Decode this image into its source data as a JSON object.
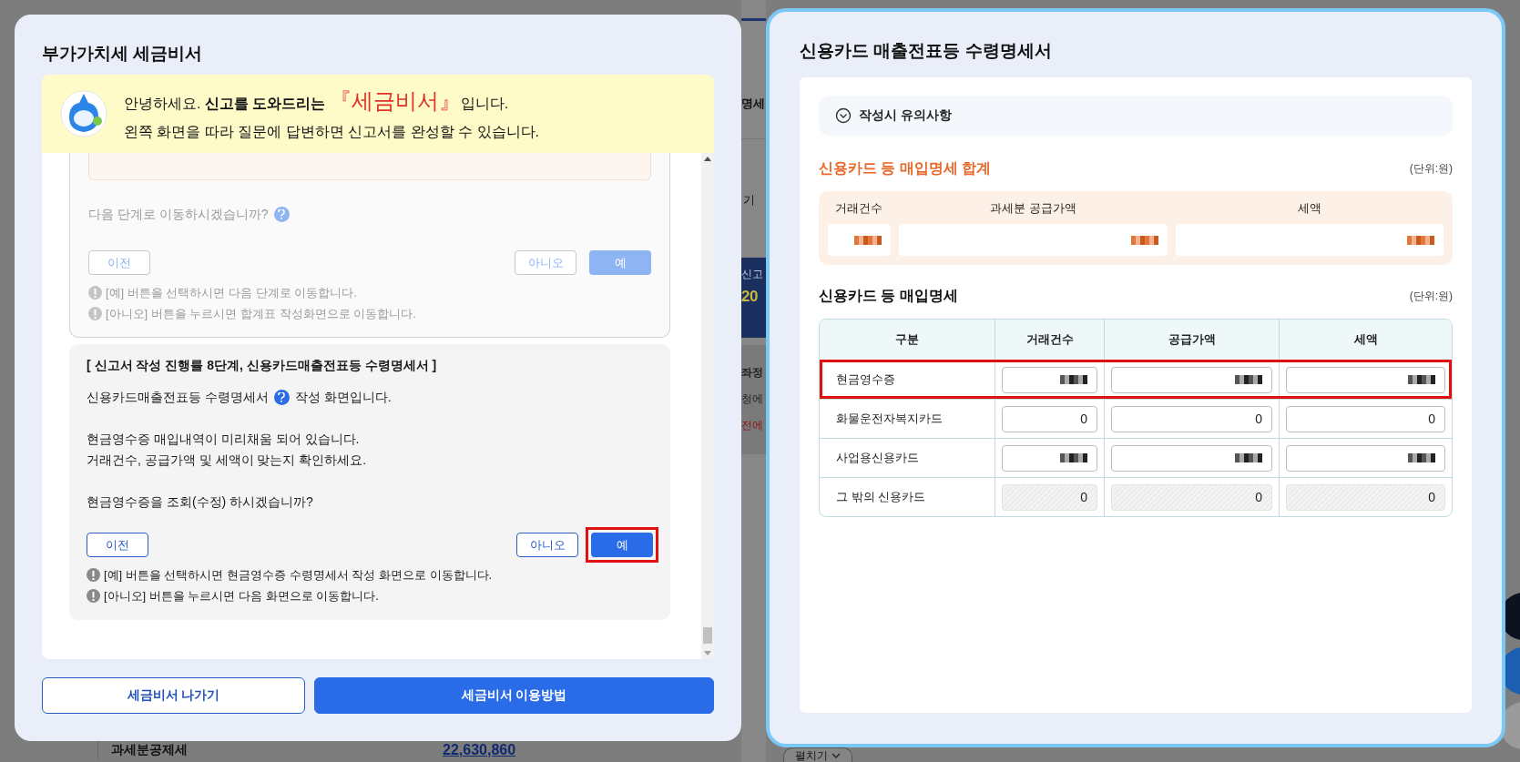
{
  "background": {
    "header_fragment": "명세",
    "tab_fragment": "기",
    "banner_fragments": [
      "신고",
      "20"
    ],
    "notice_fragments": [
      {
        "text": "좌정",
        "kind": "title"
      },
      {
        "text": "청에",
        "kind": "plain"
      },
      {
        "text": "전에",
        "kind": "alert"
      }
    ],
    "summary_label": "과세분공제세",
    "summary_value": "22,630,860",
    "expand_button": "펼치기"
  },
  "left_modal": {
    "title": "부가가치세 세금비서",
    "banner": {
      "greeting": "안녕하세요.",
      "lead": "신고를 도와드리는",
      "brand": "『세금비서』",
      "tail": "입니다.",
      "line_2": "왼쪽 화면을 따라 질문에 답변하면 신고서를 완성할 수 있습니다."
    },
    "steps": [
      {
        "disabled": true,
        "cut_top": true,
        "question": "다음 단계로 이동하시겠습니까?",
        "question_help": true,
        "prev": "이전",
        "no": "아니오",
        "yes": "예",
        "yes_highlighted": false,
        "notes": [
          "[예] 버튼을 선택하시면 다음 단계로 이동합니다.",
          "[아니오] 버튼을 누르시면 합계표 작성화면으로 이동합니다."
        ]
      },
      {
        "disabled": false,
        "cut_top": false,
        "heading": "[ 신고서 작성 진행률 8단계, 신용카드매출전표등 수령명세서 ]",
        "intro_before": "신용카드매출전표등 수령명세서",
        "intro_after": "작성 화면입니다.",
        "lines": [
          "현금영수증 매입내역이 미리채움 되어 있습니다.",
          "거래건수, 공급가액 및 세액이 맞는지 확인하세요."
        ],
        "question": "현금영수증을 조회(수정) 하시겠습니까?",
        "question_help": false,
        "prev": "이전",
        "no": "아니오",
        "yes": "예",
        "yes_highlighted": true,
        "notes": [
          "[예] 버튼을 선택하시면 현금영수증 수령명세서 작성 화면으로 이동합니다.",
          "[아니오] 버튼을 누르시면 다음 화면으로 이동합니다."
        ]
      }
    ],
    "exit_button": "세금비서 나가기",
    "guide_button": "세금비서 이용방법"
  },
  "right_modal": {
    "title": "신용카드 매출전표등 수령명세서",
    "notice": {
      "label": "작성시 유의사항",
      "expanded": false
    },
    "summary": {
      "title": "신용카드 등 매입명세 합계",
      "unit": "(단위:원)",
      "columns": [
        "거래건수",
        "과세분 공급가액",
        "세액"
      ],
      "cells": [
        {
          "redacted": true
        },
        {
          "redacted": true
        },
        {
          "redacted": true
        }
      ]
    },
    "detail": {
      "title": "신용카드 등 매입명세",
      "unit": "(단위:원)",
      "label_column": "구분",
      "columns": [
        "거래건수",
        "공급가액",
        "세액"
      ],
      "rows": [
        {
          "label": "현금영수증",
          "highlighted": true,
          "kind": "input",
          "cells": [
            {
              "redacted": true
            },
            {
              "redacted": true
            },
            {
              "redacted": true
            }
          ]
        },
        {
          "label": "화물운전자복지카드",
          "highlighted": false,
          "kind": "input",
          "cells": [
            {
              "value": "0"
            },
            {
              "value": "0"
            },
            {
              "value": "0"
            }
          ]
        },
        {
          "label": "사업용신용카드",
          "highlighted": false,
          "kind": "input",
          "cells": [
            {
              "redacted": true
            },
            {
              "redacted": true
            },
            {
              "redacted": true
            }
          ]
        },
        {
          "label": "그 밖의 신용카드",
          "highlighted": false,
          "kind": "readonly",
          "cells": [
            {
              "value": "0"
            },
            {
              "value": "0"
            },
            {
              "value": "0"
            }
          ]
        }
      ]
    }
  }
}
